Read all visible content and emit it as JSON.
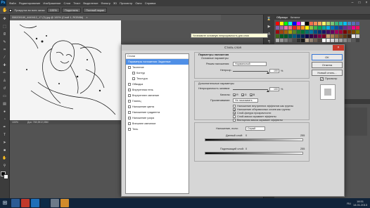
{
  "app": {
    "logo": "Ps",
    "menu": [
      "Файл",
      "Редактирование",
      "Изображение",
      "Слои",
      "Текст",
      "Выделение",
      "Фильтр",
      "3D",
      "Просмотр",
      "Окно",
      "Справка"
    ]
  },
  "options": {
    "checkbox_label": "Прокрутка во всех окнах",
    "zoom": "100%",
    "fit_label": "Подогнать",
    "fullscreen_label": "Полный экран"
  },
  "document": {
    "tab": "558209189_4449412_17 (3).jpg @ 100% (Слой 1, RGB/8#)",
    "status": "100%",
    "status_doc": "Док: 769,9K/2,05M"
  },
  "panels": {
    "tabs": [
      "Образцы",
      "Каталог"
    ],
    "active_tab": "Образцы"
  },
  "swatch_colors": [
    "#ff0000",
    "#ffff00",
    "#00ff00",
    "#00ffff",
    "#0000ff",
    "#ff00ff",
    "#ffffff",
    "#000000",
    "#f26c4f",
    "#f68e55",
    "#fbaf5c",
    "#fff467",
    "#acd372",
    "#7cc576",
    "#3bb878",
    "#1abbb4",
    "#00bff3",
    "#438ccb",
    "#5574b9",
    "#605ca8",
    "#855fa8",
    "#a763a8",
    "#f06eaa",
    "#f26d7d",
    "#ed1c24",
    "#f26522",
    "#f7941d",
    "#fff200",
    "#8dc73f",
    "#39b54a",
    "#00a651",
    "#00a99d",
    "#00aeef",
    "#0072bc",
    "#0054a6",
    "#2e3192",
    "#662d91",
    "#92278f",
    "#ec008c",
    "#ed145b",
    "#9e0b0f",
    "#a0410d",
    "#a36209",
    "#aba000",
    "#598527",
    "#1a7b30",
    "#007236",
    "#00746b",
    "#0076a3",
    "#004b80",
    "#003471",
    "#1b1464",
    "#440e62",
    "#630460",
    "#9e005d",
    "#9e0039",
    "#790000",
    "#7b2e00",
    "#7d4900",
    "#827b00",
    "#406618",
    "#005e20",
    "#005826",
    "#005952",
    "#005b7f",
    "#003663",
    "#002157",
    "#0d004c",
    "#32004b",
    "#4b0049",
    "#7b0046",
    "#7a0026",
    "#c69c6d",
    "#a67c52",
    "#8c6239",
    "#754c24",
    "#603913",
    "#3c2415",
    "#e6e6e6",
    "#cccccc",
    "#b3b3b3",
    "#999999",
    "#808080",
    "#666666",
    "#4d4d4d",
    "#333333",
    "#1a1a1a",
    "#c7b299",
    "#998675",
    "#736357",
    "#534741",
    "#ffffff",
    "#f2f2f2",
    "#d9d9d9",
    "#bfbfbf",
    "#a6a6a6",
    "#8c8c8c",
    "#737373",
    "#595959",
    "#404040"
  ],
  "dialog": {
    "title": "Стиль слоя",
    "styles_header": "Стили",
    "styles": [
      {
        "label": "Параметры наложения: Заданные",
        "checked": null,
        "selected": true,
        "indent": false
      },
      {
        "label": "Тиснение",
        "checked": false,
        "selected": false,
        "indent": false
      },
      {
        "label": "Контур",
        "checked": false,
        "selected": false,
        "indent": true
      },
      {
        "label": "Текстура",
        "checked": false,
        "selected": false,
        "indent": true
      },
      {
        "label": "Обводка",
        "checked": false,
        "selected": false,
        "indent": false
      },
      {
        "label": "Внутренняя тень",
        "checked": false,
        "selected": false,
        "indent": false
      },
      {
        "label": "Внутреннее свечение",
        "checked": false,
        "selected": false,
        "indent": false
      },
      {
        "label": "Глянец",
        "checked": false,
        "selected": false,
        "indent": false
      },
      {
        "label": "Наложение цвета",
        "checked": false,
        "selected": false,
        "indent": false
      },
      {
        "label": "Наложение градиента",
        "checked": false,
        "selected": false,
        "indent": false
      },
      {
        "label": "Наложение узора",
        "checked": false,
        "selected": false,
        "indent": false
      },
      {
        "label": "Внешнее свечение",
        "checked": false,
        "selected": false,
        "indent": false
      },
      {
        "label": "Тень",
        "checked": false,
        "selected": false,
        "indent": false
      }
    ],
    "blend_header": "Параметры наложения",
    "general_header": "Основные параметры",
    "blend_mode_label": "Режим наложения:",
    "blend_mode": "Нормальный",
    "opacity_label": "Непрозр.:",
    "opacity_value": "100",
    "opacity_fraction": 1,
    "pct": "%",
    "adv_header": "Дополнительные параметры",
    "fill_label": "Непрозрачность заливки:",
    "fill_value": "100",
    "fill_fraction": 1,
    "channels_label": "Каналы:",
    "channels": [
      "R",
      "G",
      "B"
    ],
    "knockout_label": "Просвечивание:",
    "knockout_value": "Не показывать",
    "options": [
      {
        "label": "Наложение внутренних эффектов как группы",
        "checked": false
      },
      {
        "label": "Наложение обтравочных слоев как группы",
        "checked": true
      },
      {
        "label": "Слой-фигура прозрачности",
        "checked": true
      },
      {
        "label": "Слой-маска скрывает эффекты",
        "checked": false
      },
      {
        "label": "Векторная маска скрывает эффекты",
        "checked": false
      }
    ],
    "blendif_label": "Наложение, если:",
    "blendif_value": "Серый",
    "this_layer_label": "Данный слой:",
    "this_layer_min": "0",
    "this_layer_max": "255",
    "under_layer_label": "Подлежащий слой:",
    "under_layer_min": "0",
    "under_layer_max": "255",
    "ok": "OK",
    "cancel": "Отмена",
    "new_style": "Новый стиль...",
    "preview_label": "Просмотр"
  },
  "tooltip": "Установите основную непрозрачность для слоя",
  "taskbar": {
    "lang": "RU",
    "time": "18:51",
    "date": "14.01.2013"
  }
}
